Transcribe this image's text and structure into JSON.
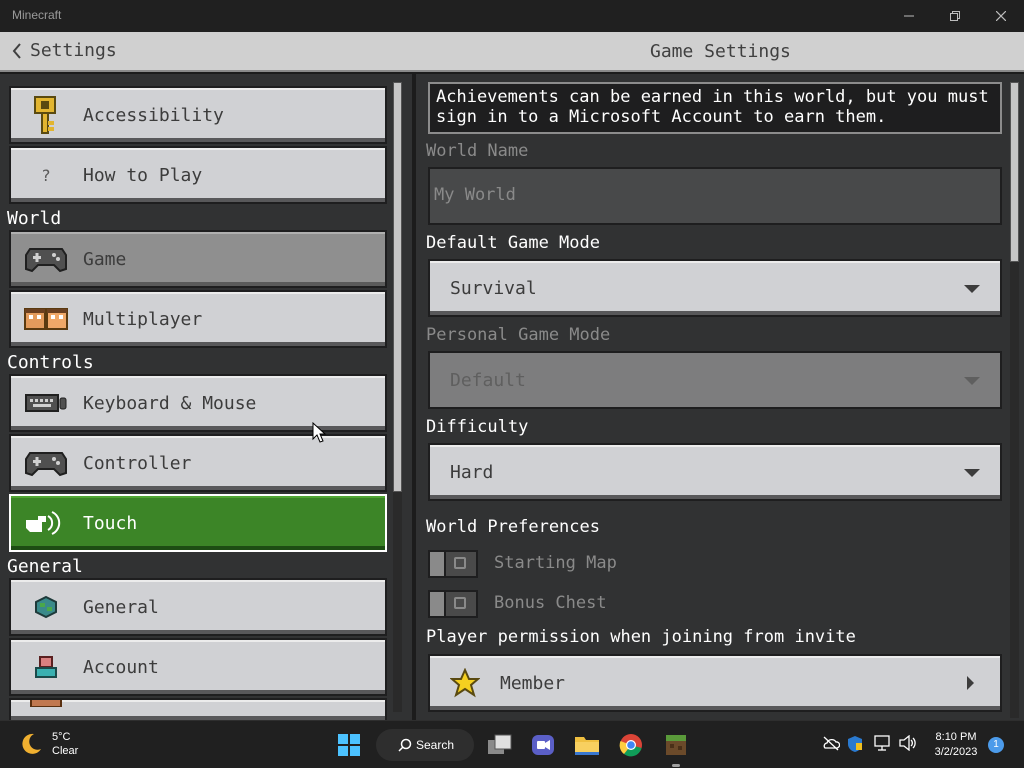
{
  "window": {
    "title": "Minecraft"
  },
  "header": {
    "back_label": "Settings",
    "title": "Game Settings"
  },
  "sidebar": {
    "items": [
      {
        "label": "Accessibility",
        "icon": "key-icon"
      },
      {
        "label": "How to Play",
        "icon": "question-icon"
      },
      {
        "label": "Game",
        "icon": "controller-icon"
      },
      {
        "label": "Multiplayer",
        "icon": "players-icon"
      },
      {
        "label": "Keyboard & Mouse",
        "icon": "keyboard-icon"
      },
      {
        "label": "Controller",
        "icon": "controller-icon"
      },
      {
        "label": "Touch",
        "icon": "touch-hand-icon"
      },
      {
        "label": "General",
        "icon": "globe-icon"
      },
      {
        "label": "Account",
        "icon": "account-icon"
      }
    ],
    "sections": {
      "world": "World",
      "controls": "Controls",
      "general": "General"
    }
  },
  "game_settings": {
    "notice": "Achievements can be earned in this world, but you must sign in to a Microsoft Account to earn them.",
    "world_name_label": "World Name",
    "world_name_placeholder": "My World",
    "default_game_mode_label": "Default Game Mode",
    "default_game_mode_value": "Survival",
    "personal_game_mode_label": "Personal Game Mode",
    "personal_game_mode_value": "Default",
    "difficulty_label": "Difficulty",
    "difficulty_value": "Hard",
    "world_preferences_label": "World Preferences",
    "starting_map_label": "Starting Map",
    "starting_map_on": false,
    "bonus_chest_label": "Bonus Chest",
    "bonus_chest_on": false,
    "player_permission_label": "Player permission when joining from invite",
    "player_permission_value": "Member"
  },
  "taskbar": {
    "weather_temp": "5°C",
    "weather_desc": "Clear",
    "search_label": "Search",
    "time": "8:10 PM",
    "date": "3/2/2023",
    "notification_count": "1"
  },
  "colors": {
    "accent_green": "#3c8527",
    "panel": "#313233",
    "button": "#d0d1d4"
  }
}
